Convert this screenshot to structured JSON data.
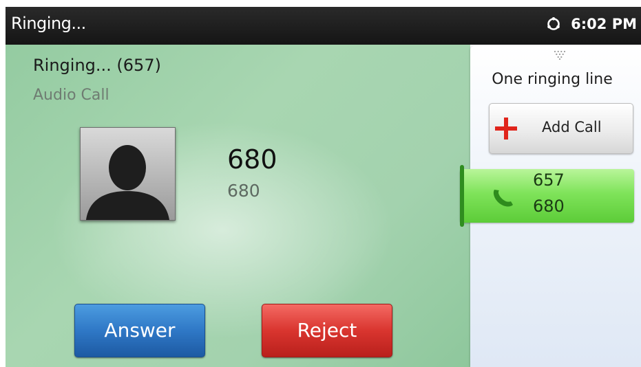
{
  "status_bar": {
    "title": "Ringing...",
    "time": "6:02 PM",
    "icon": "network-icon"
  },
  "call": {
    "status": "Ringing... (657)",
    "type": "Audio Call",
    "caller_name": "680",
    "caller_number": "680",
    "avatar_icon": "person-silhouette-icon"
  },
  "actions": {
    "answer_label": "Answer",
    "reject_label": "Reject",
    "answer_color": "#2f78c6",
    "reject_color": "#d9352f"
  },
  "side_panel": {
    "handle_icon": "pull-handle-icon",
    "ringing_lines": "One ringing line",
    "add_call_label": "Add Call",
    "add_call_icon": "plus-icon",
    "line": {
      "number": "657",
      "caller": "680",
      "icon": "phone-icon",
      "color": "#7fe35a"
    }
  }
}
